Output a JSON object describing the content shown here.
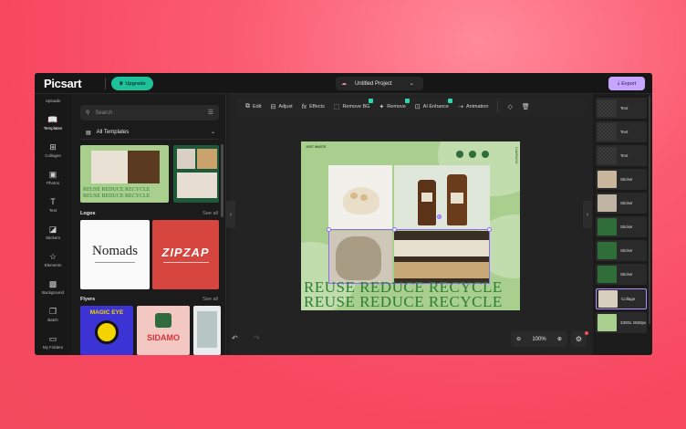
{
  "app": {
    "logo": "Picsart",
    "upgrade": "Upgrade",
    "project_title": "Untitled Project",
    "export": "Export"
  },
  "rail": [
    {
      "label": "Uploads"
    },
    {
      "label": "Templates",
      "icon": "book-icon"
    },
    {
      "label": "Collages",
      "icon": "grid-icon"
    },
    {
      "label": "Photos",
      "icon": "photo-icon"
    },
    {
      "label": "Text",
      "icon": "text-icon"
    },
    {
      "label": "Stickers",
      "icon": "sticker-icon"
    },
    {
      "label": "Elements",
      "icon": "star-icon"
    },
    {
      "label": "Background",
      "icon": "pattern-icon"
    },
    {
      "label": "Batch",
      "icon": "stack-icon"
    },
    {
      "label": "My Folders",
      "icon": "folder-icon"
    }
  ],
  "panel": {
    "search_placeholder": "Search",
    "category": "All Templates",
    "reuse_text": "REUSE REDUCE RECYCLE",
    "logos_title": "Logos",
    "see_all": "See all",
    "logo1": "Nomads",
    "logo2": "ZIPZAP",
    "flyers_title": "Flyers",
    "flyer1": "MAGIC EYE",
    "flyer2": "SIDAMO"
  },
  "toolbar": {
    "edit": "Edit",
    "adjust": "Adjust",
    "effects": "Effects",
    "remove_bg": "Remove BG",
    "remove": "Remove",
    "ai_enhance": "AI Enhance",
    "animation": "Animation"
  },
  "artboard": {
    "header": "JUST WASTE",
    "side": "CAMPAIGN",
    "line1": "REUSE REDUCE RECYCLE",
    "line2": "REUSE REDUCE RECYCLE"
  },
  "zoom": {
    "value": "100%"
  },
  "layers": [
    {
      "label": "Text"
    },
    {
      "label": "Text"
    },
    {
      "label": "Text"
    },
    {
      "label": "Sticker"
    },
    {
      "label": "Sticker"
    },
    {
      "label": "Sticker"
    },
    {
      "label": "Sticker"
    },
    {
      "label": "Sticker"
    },
    {
      "label": "Collage"
    },
    {
      "label": "3300x 2550px"
    }
  ],
  "colors": {
    "accent": "#c6a5ff",
    "upgrade": "#1ec29a",
    "artboard_bg": "#a9cf8e",
    "text_green": "#2f7d34"
  }
}
